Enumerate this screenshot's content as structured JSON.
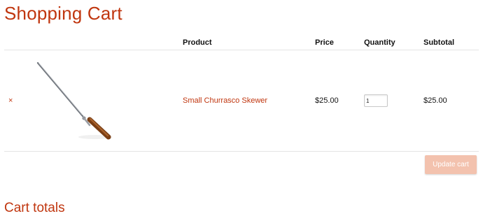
{
  "page": {
    "title": "Shopping Cart"
  },
  "cart": {
    "columns": {
      "remove": "",
      "thumbnail": "",
      "product": "Product",
      "price": "Price",
      "quantity": "Quantity",
      "subtotal": "Subtotal"
    },
    "items": [
      {
        "remove_label": "×",
        "product_name": "Small Churrasco Skewer",
        "price": "$25.00",
        "quantity": "1",
        "subtotal": "$25.00",
        "thumbnail_icon": "skewer-image"
      }
    ],
    "update_button_label": "Update cart"
  },
  "totals": {
    "title": "Cart totals"
  },
  "colors": {
    "accent": "#c0360f",
    "button_disabled": "#f3c2ae"
  }
}
